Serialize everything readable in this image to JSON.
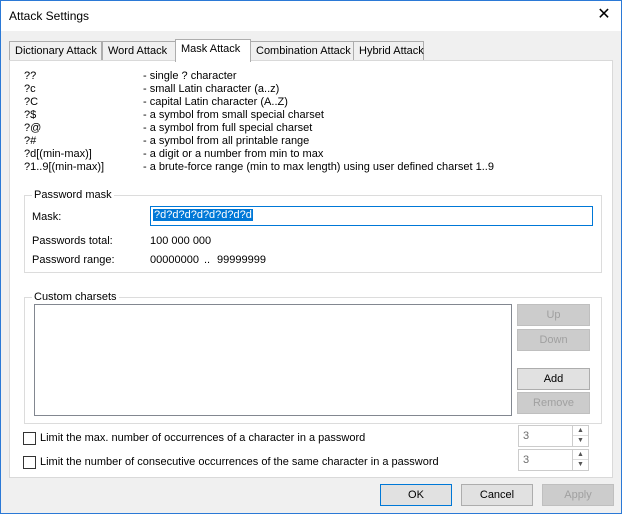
{
  "window": {
    "title": "Attack Settings"
  },
  "tabs": [
    {
      "label": "Dictionary Attack",
      "active": false
    },
    {
      "label": "Word Attack",
      "active": false
    },
    {
      "label": "Mask Attack",
      "active": true
    },
    {
      "label": "Combination Attack",
      "active": false
    },
    {
      "label": "Hybrid Attack",
      "active": false
    }
  ],
  "reference": [
    {
      "code": "??",
      "desc": "- single ? character"
    },
    {
      "code": "?c",
      "desc": "- small Latin character (a..z)"
    },
    {
      "code": "?C",
      "desc": "- capital Latin character (A..Z)"
    },
    {
      "code": "?$",
      "desc": "- a symbol from small special charset"
    },
    {
      "code": "?@",
      "desc": "- a symbol from full special charset"
    },
    {
      "code": "?#",
      "desc": "- a symbol from all printable range"
    },
    {
      "code": "?d[(min-max)]",
      "desc": "- a digit or a number from min to max"
    },
    {
      "code": "?1..9[(min-max)]",
      "desc": "- a brute-force range (min to max length) using user defined charset 1..9"
    }
  ],
  "password_mask": {
    "legend": "Password mask",
    "mask_label": "Mask:",
    "mask_value": "?d?d?d?d?d?d?d?d",
    "total_label": "Passwords total:",
    "total_value": "100 000 000",
    "range_label": "Password range:",
    "range_from": "00000000",
    "range_sep": "..",
    "range_to": "99999999"
  },
  "custom_charsets": {
    "legend": "Custom charsets",
    "up": "Up",
    "down": "Down",
    "add": "Add",
    "remove": "Remove"
  },
  "limits": {
    "max_occurrences": {
      "label": "Limit the max. number of occurrences of a character in a password",
      "checked": false,
      "value": "3"
    },
    "consecutive": {
      "label": "Limit the number of consecutive occurrences of the same character in a password",
      "checked": false,
      "value": "3"
    }
  },
  "footer": {
    "ok": "OK",
    "cancel": "Cancel",
    "apply": "Apply"
  }
}
